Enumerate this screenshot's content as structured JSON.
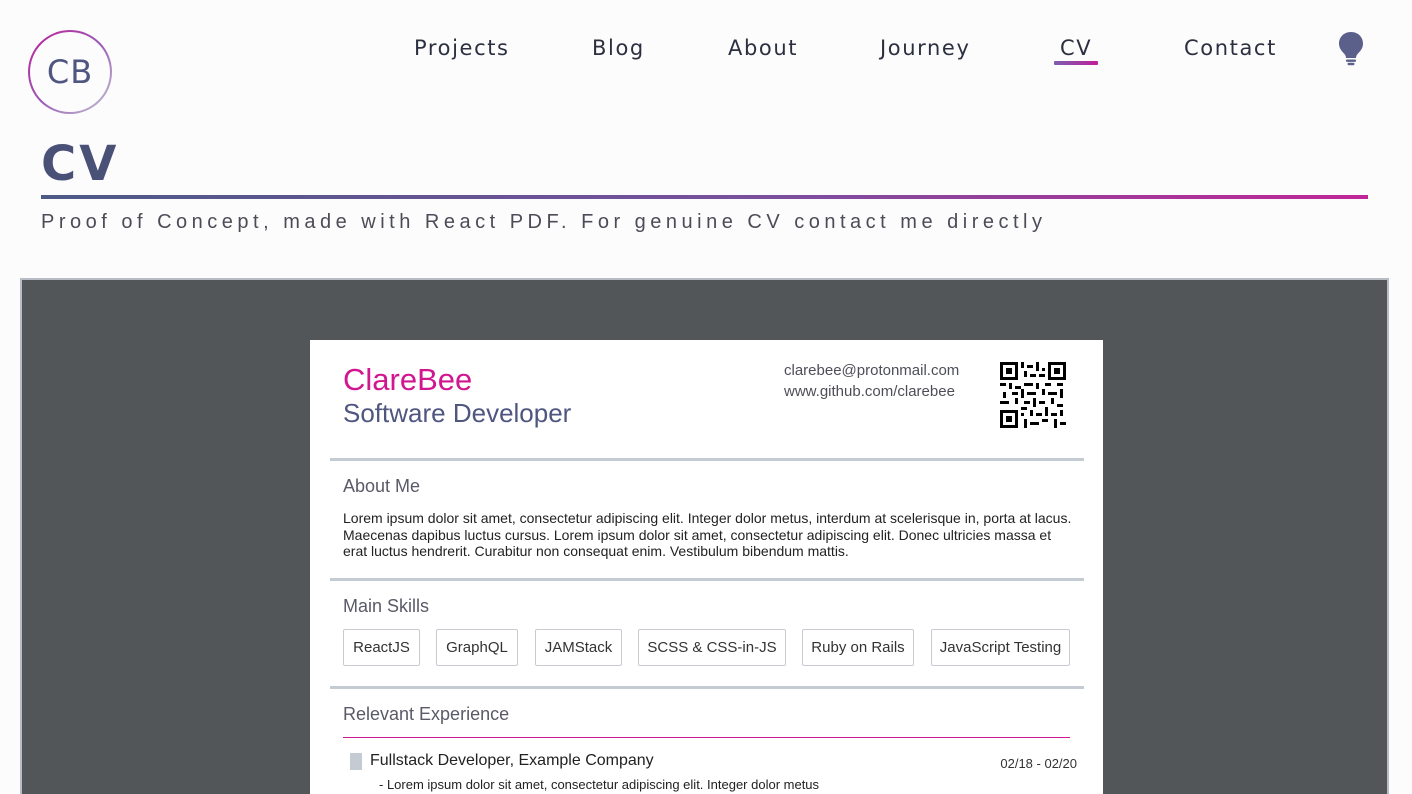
{
  "header": {
    "logo_text": "CB",
    "nav": [
      {
        "label": "Projects",
        "active": false
      },
      {
        "label": "Blog",
        "active": false
      },
      {
        "label": "About",
        "active": false
      },
      {
        "label": "Journey",
        "active": false
      },
      {
        "label": "CV",
        "active": true
      },
      {
        "label": "Contact",
        "active": false
      }
    ],
    "theme_toggle_icon": "lightbulb-icon"
  },
  "page": {
    "title": "CV",
    "subtitle": "Proof of Concept, made with React PDF. For genuine CV contact me directly"
  },
  "cv": {
    "name": "ClareBee",
    "role": "Software Developer",
    "email": "clarebee@protonmail.com",
    "website": "www.github.com/clarebee",
    "qr_icon": "qr-code-icon",
    "about": {
      "heading": "About Me",
      "text": "Lorem ipsum dolor sit amet, consectetur adipiscing elit. Integer dolor metus, interdum at scelerisque in, porta at lacus. Maecenas dapibus luctus cursus. Lorem ipsum dolor sit amet, consectetur adipiscing elit. Donec ultricies massa et erat luctus hendrerit. Curabitur non consequat enim. Vestibulum bibendum mattis."
    },
    "skills": {
      "heading": "Main Skills",
      "items": [
        "ReactJS",
        "GraphQL",
        "JAMStack",
        "SCSS & CSS-in-JS",
        "Ruby on Rails",
        "JavaScript Testing"
      ]
    },
    "experience": {
      "heading": "Relevant Experience",
      "items": [
        {
          "title": "Fullstack Developer, Example Company",
          "dates": "02/18 - 02/20",
          "bullet": "- Lorem ipsum dolor sit amet, consectetur adipiscing elit. Integer dolor metus"
        }
      ]
    }
  },
  "colors": {
    "accent_magenta": "#d1168f",
    "accent_slate": "#4f5680",
    "viewer_bg": "#525659",
    "separator": "#c5cbd3"
  }
}
